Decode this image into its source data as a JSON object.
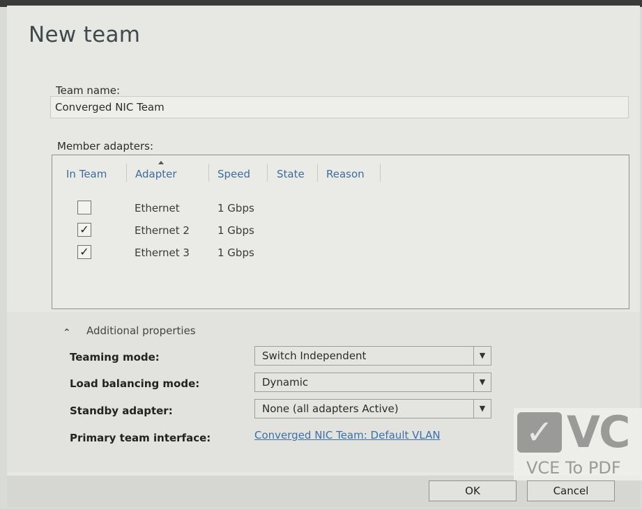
{
  "dialog": {
    "title": "New team"
  },
  "team_name": {
    "label": "Team name:",
    "value": "Converged NIC Team"
  },
  "members": {
    "label": "Member adapters:",
    "columns": [
      "In Team",
      "Adapter",
      "Speed",
      "State",
      "Reason"
    ],
    "rows": [
      {
        "checked": false,
        "check_glyph": "",
        "adapter": "Ethernet",
        "speed": "1 Gbps"
      },
      {
        "checked": true,
        "check_glyph": "✓",
        "adapter": "Ethernet 2",
        "speed": "1 Gbps"
      },
      {
        "checked": true,
        "check_glyph": "✓",
        "adapter": "Ethernet 3",
        "speed": "1 Gbps"
      }
    ]
  },
  "additional": {
    "toggle_icon": "chevron-up-icon",
    "label": "Additional properties",
    "teaming_mode": {
      "label": "Teaming mode:",
      "value": "Switch Independent"
    },
    "load_balancing": {
      "label": "Load balancing mode:",
      "value": "Dynamic"
    },
    "standby": {
      "label": "Standby adapter:",
      "value": "None (all adapters Active)"
    },
    "primary_interface": {
      "label": "Primary team interface:",
      "value": "Converged NIC Team: Default VLAN"
    }
  },
  "buttons": {
    "ok": "OK",
    "cancel": "Cancel"
  },
  "watermark": {
    "logo": "VC",
    "text": "VCE To PDF"
  },
  "colors": {
    "header_text": "#3f6b9a",
    "link": "#3d6fa6",
    "title": "#3e4a4c"
  }
}
